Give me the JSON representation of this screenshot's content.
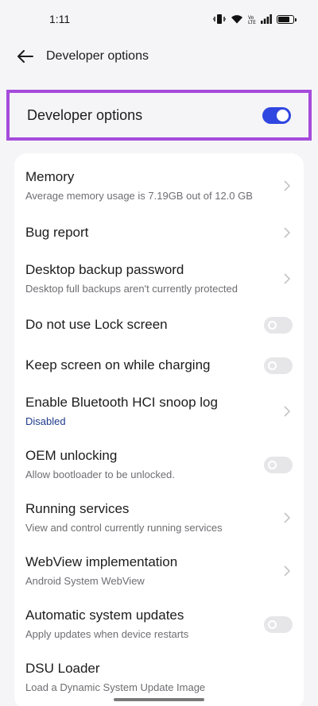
{
  "status_bar": {
    "time": "1:11",
    "icons": [
      "vibrate-icon",
      "wifi-icon",
      "volte-icon",
      "signal-icon",
      "battery-icon"
    ]
  },
  "header": {
    "title": "Developer options",
    "back_icon": "back-arrow-icon"
  },
  "master_switch": {
    "label": "Developer options",
    "state": "on",
    "accent": "#3046e0",
    "highlight_color": "#a64bdc"
  },
  "settings": [
    {
      "title": "Memory",
      "subtitle": "Average memory usage is 7.19GB out of 12.0 GB",
      "control": "chevron"
    },
    {
      "title": "Bug report",
      "subtitle": "",
      "control": "chevron"
    },
    {
      "title": "Desktop backup password",
      "subtitle": "Desktop full backups aren't currently protected",
      "control": "chevron"
    },
    {
      "title": "Do not use Lock screen",
      "subtitle": "",
      "control": "toggle-off"
    },
    {
      "title": "Keep screen on while charging",
      "subtitle": "",
      "control": "toggle-off"
    },
    {
      "title": "Enable Bluetooth HCI snoop log",
      "subtitle": "Disabled",
      "control": "chevron"
    },
    {
      "title": "OEM unlocking",
      "subtitle": "Allow bootloader to be unlocked.",
      "control": "toggle-off"
    },
    {
      "title": "Running services",
      "subtitle": "View and control currently running services",
      "control": "chevron"
    },
    {
      "title": "WebView implementation",
      "subtitle": "Android System WebView",
      "control": "chevron"
    },
    {
      "title": "Automatic system updates",
      "subtitle": "Apply updates when device restarts",
      "control": "toggle-off"
    },
    {
      "title": "DSU Loader",
      "subtitle": "Load a Dynamic System Update Image",
      "control": "chevron"
    }
  ]
}
